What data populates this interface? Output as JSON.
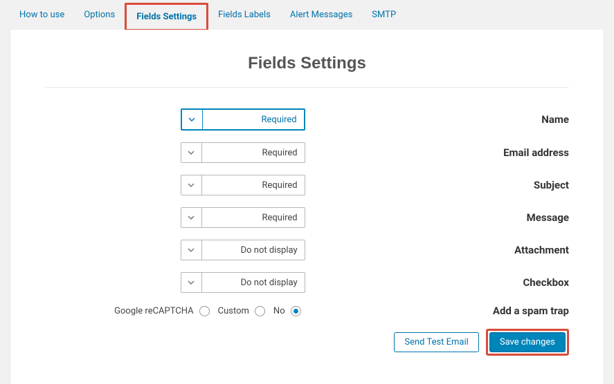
{
  "tabs": {
    "how_to_use": "How to use",
    "options": "Options",
    "fields_settings": "Fields Settings",
    "fields_labels": "Fields Labels",
    "alert_messages": "Alert Messages",
    "smtp": "SMTP"
  },
  "page": {
    "title": "Fields Settings"
  },
  "options": {
    "required": "Required",
    "do_not_display": "Do not display"
  },
  "fields": {
    "name": {
      "value": "Required",
      "label": "Name"
    },
    "email": {
      "value": "Required",
      "label": "Email address"
    },
    "subject": {
      "value": "Required",
      "label": "Subject"
    },
    "message": {
      "value": "Required",
      "label": "Message"
    },
    "attachment": {
      "value": "Do not display",
      "label": "Attachment"
    },
    "checkbox": {
      "value": "Do not display",
      "label": "Checkbox"
    }
  },
  "spam_trap": {
    "label": "Add a spam trap",
    "opt_recaptcha": "Google reCAPTCHA",
    "opt_custom": "Custom",
    "opt_no": "No",
    "selected": "No"
  },
  "actions": {
    "send_test": "Send Test Email",
    "save": "Save changes"
  }
}
